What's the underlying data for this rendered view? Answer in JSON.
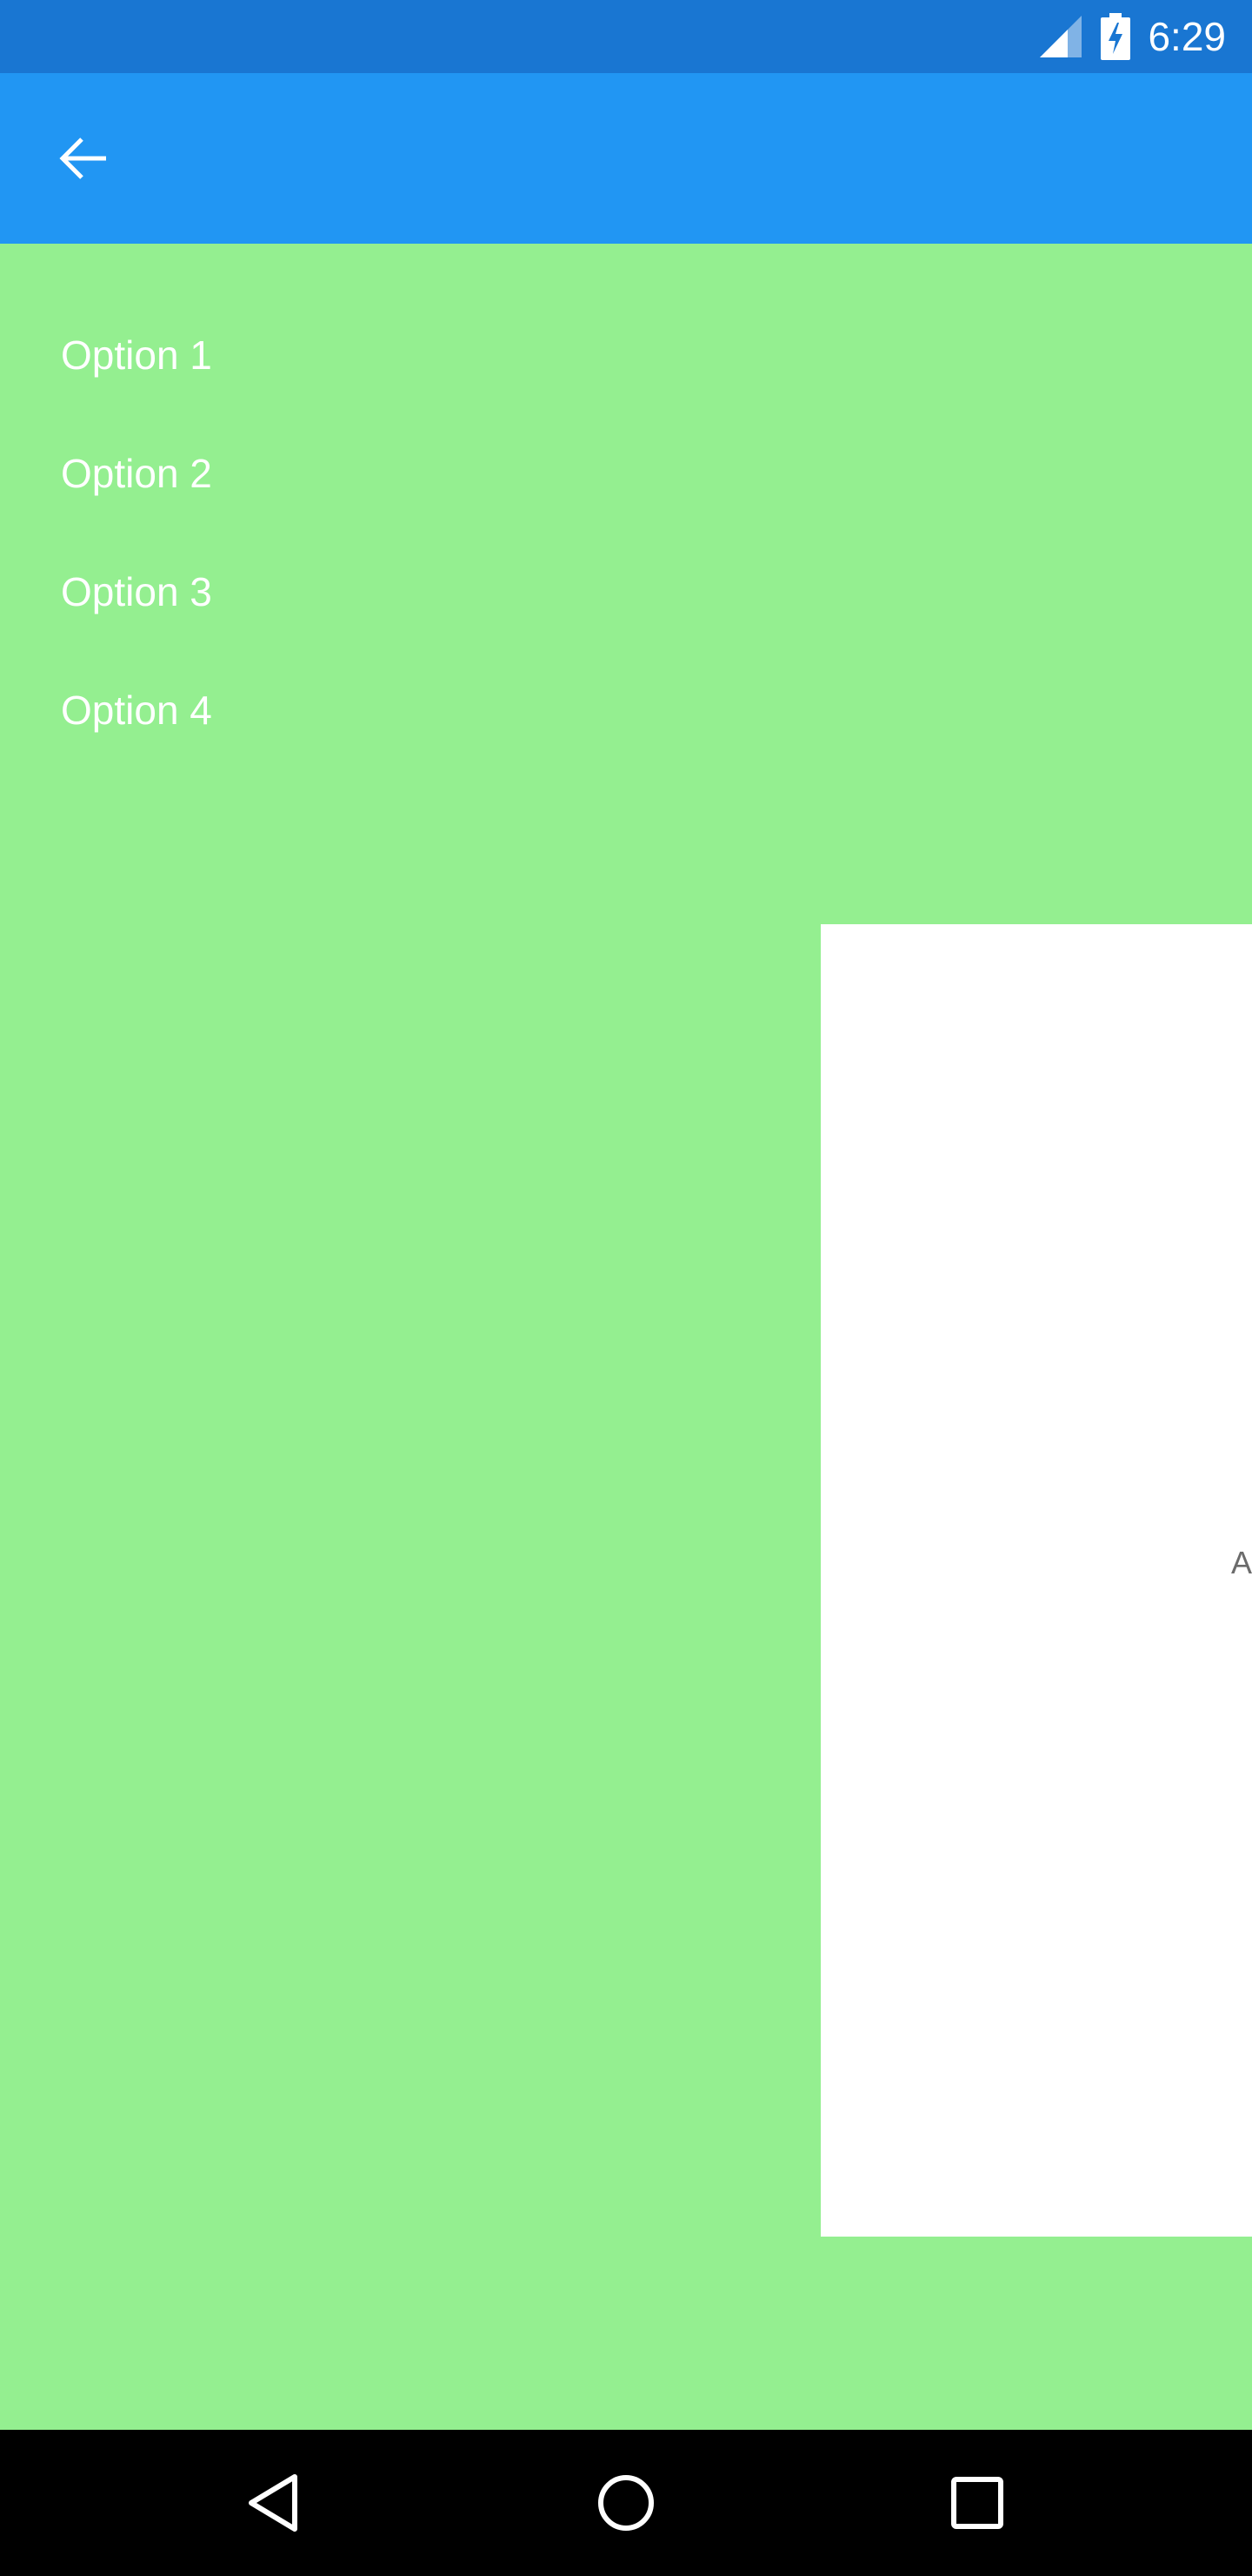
{
  "status_bar": {
    "time": "6:29",
    "icons": [
      "cell-signal-icon",
      "battery-charging-icon"
    ]
  },
  "app_bar": {
    "back_icon": "arrow-back-icon"
  },
  "menu": {
    "items": [
      {
        "label": "Option 1"
      },
      {
        "label": "Option 2"
      },
      {
        "label": "Option 3"
      },
      {
        "label": "Option 4"
      }
    ]
  },
  "panel": {
    "partial_text": "A"
  },
  "nav_bar": {
    "icons": [
      "back-triangle-icon",
      "home-circle-icon",
      "recents-square-icon"
    ]
  },
  "colors": {
    "status_bar": "#1976D2",
    "app_bar": "#2196F3",
    "background": "#94EF90",
    "panel": "#FFFFFF",
    "nav_bar": "#000000"
  }
}
